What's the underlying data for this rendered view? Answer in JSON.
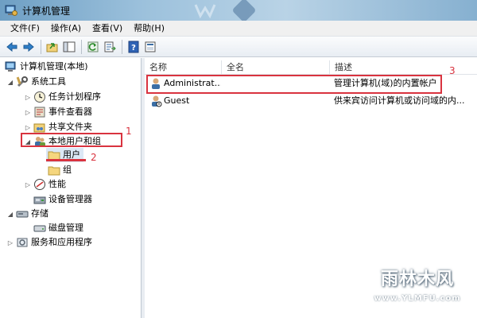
{
  "window": {
    "title": "计算机管理"
  },
  "menu": [
    "文件(F)",
    "操作(A)",
    "查看(V)",
    "帮助(H)"
  ],
  "toolbar": {
    "buttons": [
      "back-icon",
      "forward-icon",
      "up-folder-icon",
      "show-hide-tree-icon",
      "refresh-icon",
      "export-list-icon",
      "help-icon",
      "properties-icon"
    ]
  },
  "tree": {
    "root": "计算机管理(本地)",
    "system_tools": "系统工具",
    "task_scheduler": "任务计划程序",
    "event_viewer": "事件查看器",
    "shared_folders": "共享文件夹",
    "local_users_groups": "本地用户和组",
    "users": "用户",
    "groups": "组",
    "performance": "性能",
    "device_manager": "设备管理器",
    "storage": "存储",
    "disk_management": "磁盘管理",
    "services_apps": "服务和应用程序"
  },
  "list": {
    "columns": [
      "名称",
      "全名",
      "描述"
    ],
    "rows": [
      {
        "name": "Administrat...",
        "full_name": "",
        "description": "管理计算机(域)的内置帐户"
      },
      {
        "name": "Guest",
        "full_name": "",
        "description": "供来宾访问计算机或访问域的内..."
      }
    ]
  },
  "annotations": {
    "n1": "1",
    "n2": "2",
    "n3": "3"
  },
  "watermark": {
    "brand": "雨林木风",
    "url": "www.YLMFU.com"
  }
}
